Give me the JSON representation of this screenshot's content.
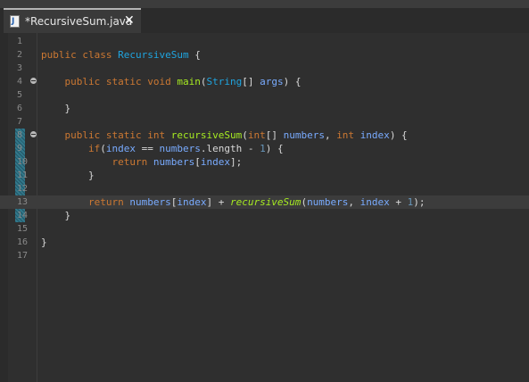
{
  "tab": {
    "icon": "java-file-icon",
    "icon_letter": "J",
    "title": "*RecursiveSum.java",
    "close": "✕"
  },
  "colors": {
    "background": "#2f2f2f",
    "keyword": "#cc7832",
    "type": "#1fa5e0",
    "method": "#a7ec21",
    "param": "#79abff",
    "text": "#d9d9d9",
    "current_line": "#3c3c3c"
  },
  "lines": [
    {
      "n": "1",
      "fold": false,
      "current": false,
      "tokens": []
    },
    {
      "n": "2",
      "fold": false,
      "current": false,
      "tokens": [
        {
          "t": "public class ",
          "c": "kw"
        },
        {
          "t": "RecursiveSum",
          "c": "cls"
        },
        {
          "t": " {",
          "c": "op"
        }
      ]
    },
    {
      "n": "3",
      "fold": false,
      "current": false,
      "tokens": []
    },
    {
      "n": "4",
      "fold": true,
      "current": false,
      "tokens": [
        {
          "t": "    public static void ",
          "c": "kw"
        },
        {
          "t": "main",
          "c": "fn"
        },
        {
          "t": "(",
          "c": "op"
        },
        {
          "t": "String",
          "c": "type"
        },
        {
          "t": "[] ",
          "c": "op"
        },
        {
          "t": "args",
          "c": "param"
        },
        {
          "t": ") {",
          "c": "op"
        }
      ]
    },
    {
      "n": "5",
      "fold": false,
      "current": false,
      "tokens": []
    },
    {
      "n": "6",
      "fold": false,
      "current": false,
      "tokens": [
        {
          "t": "    }",
          "c": "op"
        }
      ]
    },
    {
      "n": "7",
      "fold": false,
      "current": false,
      "tokens": []
    },
    {
      "n": "8",
      "fold": true,
      "current": false,
      "tokens": [
        {
          "t": "    public static ",
          "c": "kw"
        },
        {
          "t": "int ",
          "c": "kw"
        },
        {
          "t": "recursiveSum",
          "c": "fn"
        },
        {
          "t": "(",
          "c": "op"
        },
        {
          "t": "int",
          "c": "kw"
        },
        {
          "t": "[] ",
          "c": "op"
        },
        {
          "t": "numbers",
          "c": "param"
        },
        {
          "t": ", ",
          "c": "op"
        },
        {
          "t": "int ",
          "c": "kw"
        },
        {
          "t": "index",
          "c": "param"
        },
        {
          "t": ") {",
          "c": "op"
        }
      ]
    },
    {
      "n": "9",
      "fold": false,
      "current": false,
      "tokens": [
        {
          "t": "        if",
          "c": "kw"
        },
        {
          "t": "(",
          "c": "op"
        },
        {
          "t": "index",
          "c": "param"
        },
        {
          "t": " == ",
          "c": "op"
        },
        {
          "t": "numbers",
          "c": "param"
        },
        {
          "t": ".length - ",
          "c": "op"
        },
        {
          "t": "1",
          "c": "num"
        },
        {
          "t": ") {",
          "c": "op"
        }
      ]
    },
    {
      "n": "10",
      "fold": false,
      "current": false,
      "tokens": [
        {
          "t": "            return ",
          "c": "kw"
        },
        {
          "t": "numbers",
          "c": "param"
        },
        {
          "t": "[",
          "c": "op"
        },
        {
          "t": "index",
          "c": "param"
        },
        {
          "t": "];",
          "c": "op"
        }
      ]
    },
    {
      "n": "11",
      "fold": false,
      "current": false,
      "tokens": [
        {
          "t": "        }",
          "c": "op"
        }
      ]
    },
    {
      "n": "12",
      "fold": false,
      "current": false,
      "tokens": []
    },
    {
      "n": "13",
      "fold": false,
      "current": true,
      "tokens": [
        {
          "t": "        return ",
          "c": "kw"
        },
        {
          "t": "numbers",
          "c": "param"
        },
        {
          "t": "[",
          "c": "op"
        },
        {
          "t": "index",
          "c": "param"
        },
        {
          "t": "] + ",
          "c": "op"
        },
        {
          "t": "recursiveSum",
          "c": "fn it"
        },
        {
          "t": "(",
          "c": "op"
        },
        {
          "t": "numbers",
          "c": "param"
        },
        {
          "t": ", ",
          "c": "op"
        },
        {
          "t": "index",
          "c": "param"
        },
        {
          "t": " + ",
          "c": "op"
        },
        {
          "t": "1",
          "c": "num"
        },
        {
          "t": ");",
          "c": "op"
        }
      ]
    },
    {
      "n": "14",
      "fold": false,
      "current": false,
      "tokens": [
        {
          "t": "    }",
          "c": "op"
        }
      ]
    },
    {
      "n": "15",
      "fold": false,
      "current": false,
      "tokens": []
    },
    {
      "n": "16",
      "fold": false,
      "current": false,
      "tokens": [
        {
          "t": "}",
          "c": "op"
        }
      ]
    },
    {
      "n": "17",
      "fold": false,
      "current": false,
      "tokens": []
    }
  ]
}
